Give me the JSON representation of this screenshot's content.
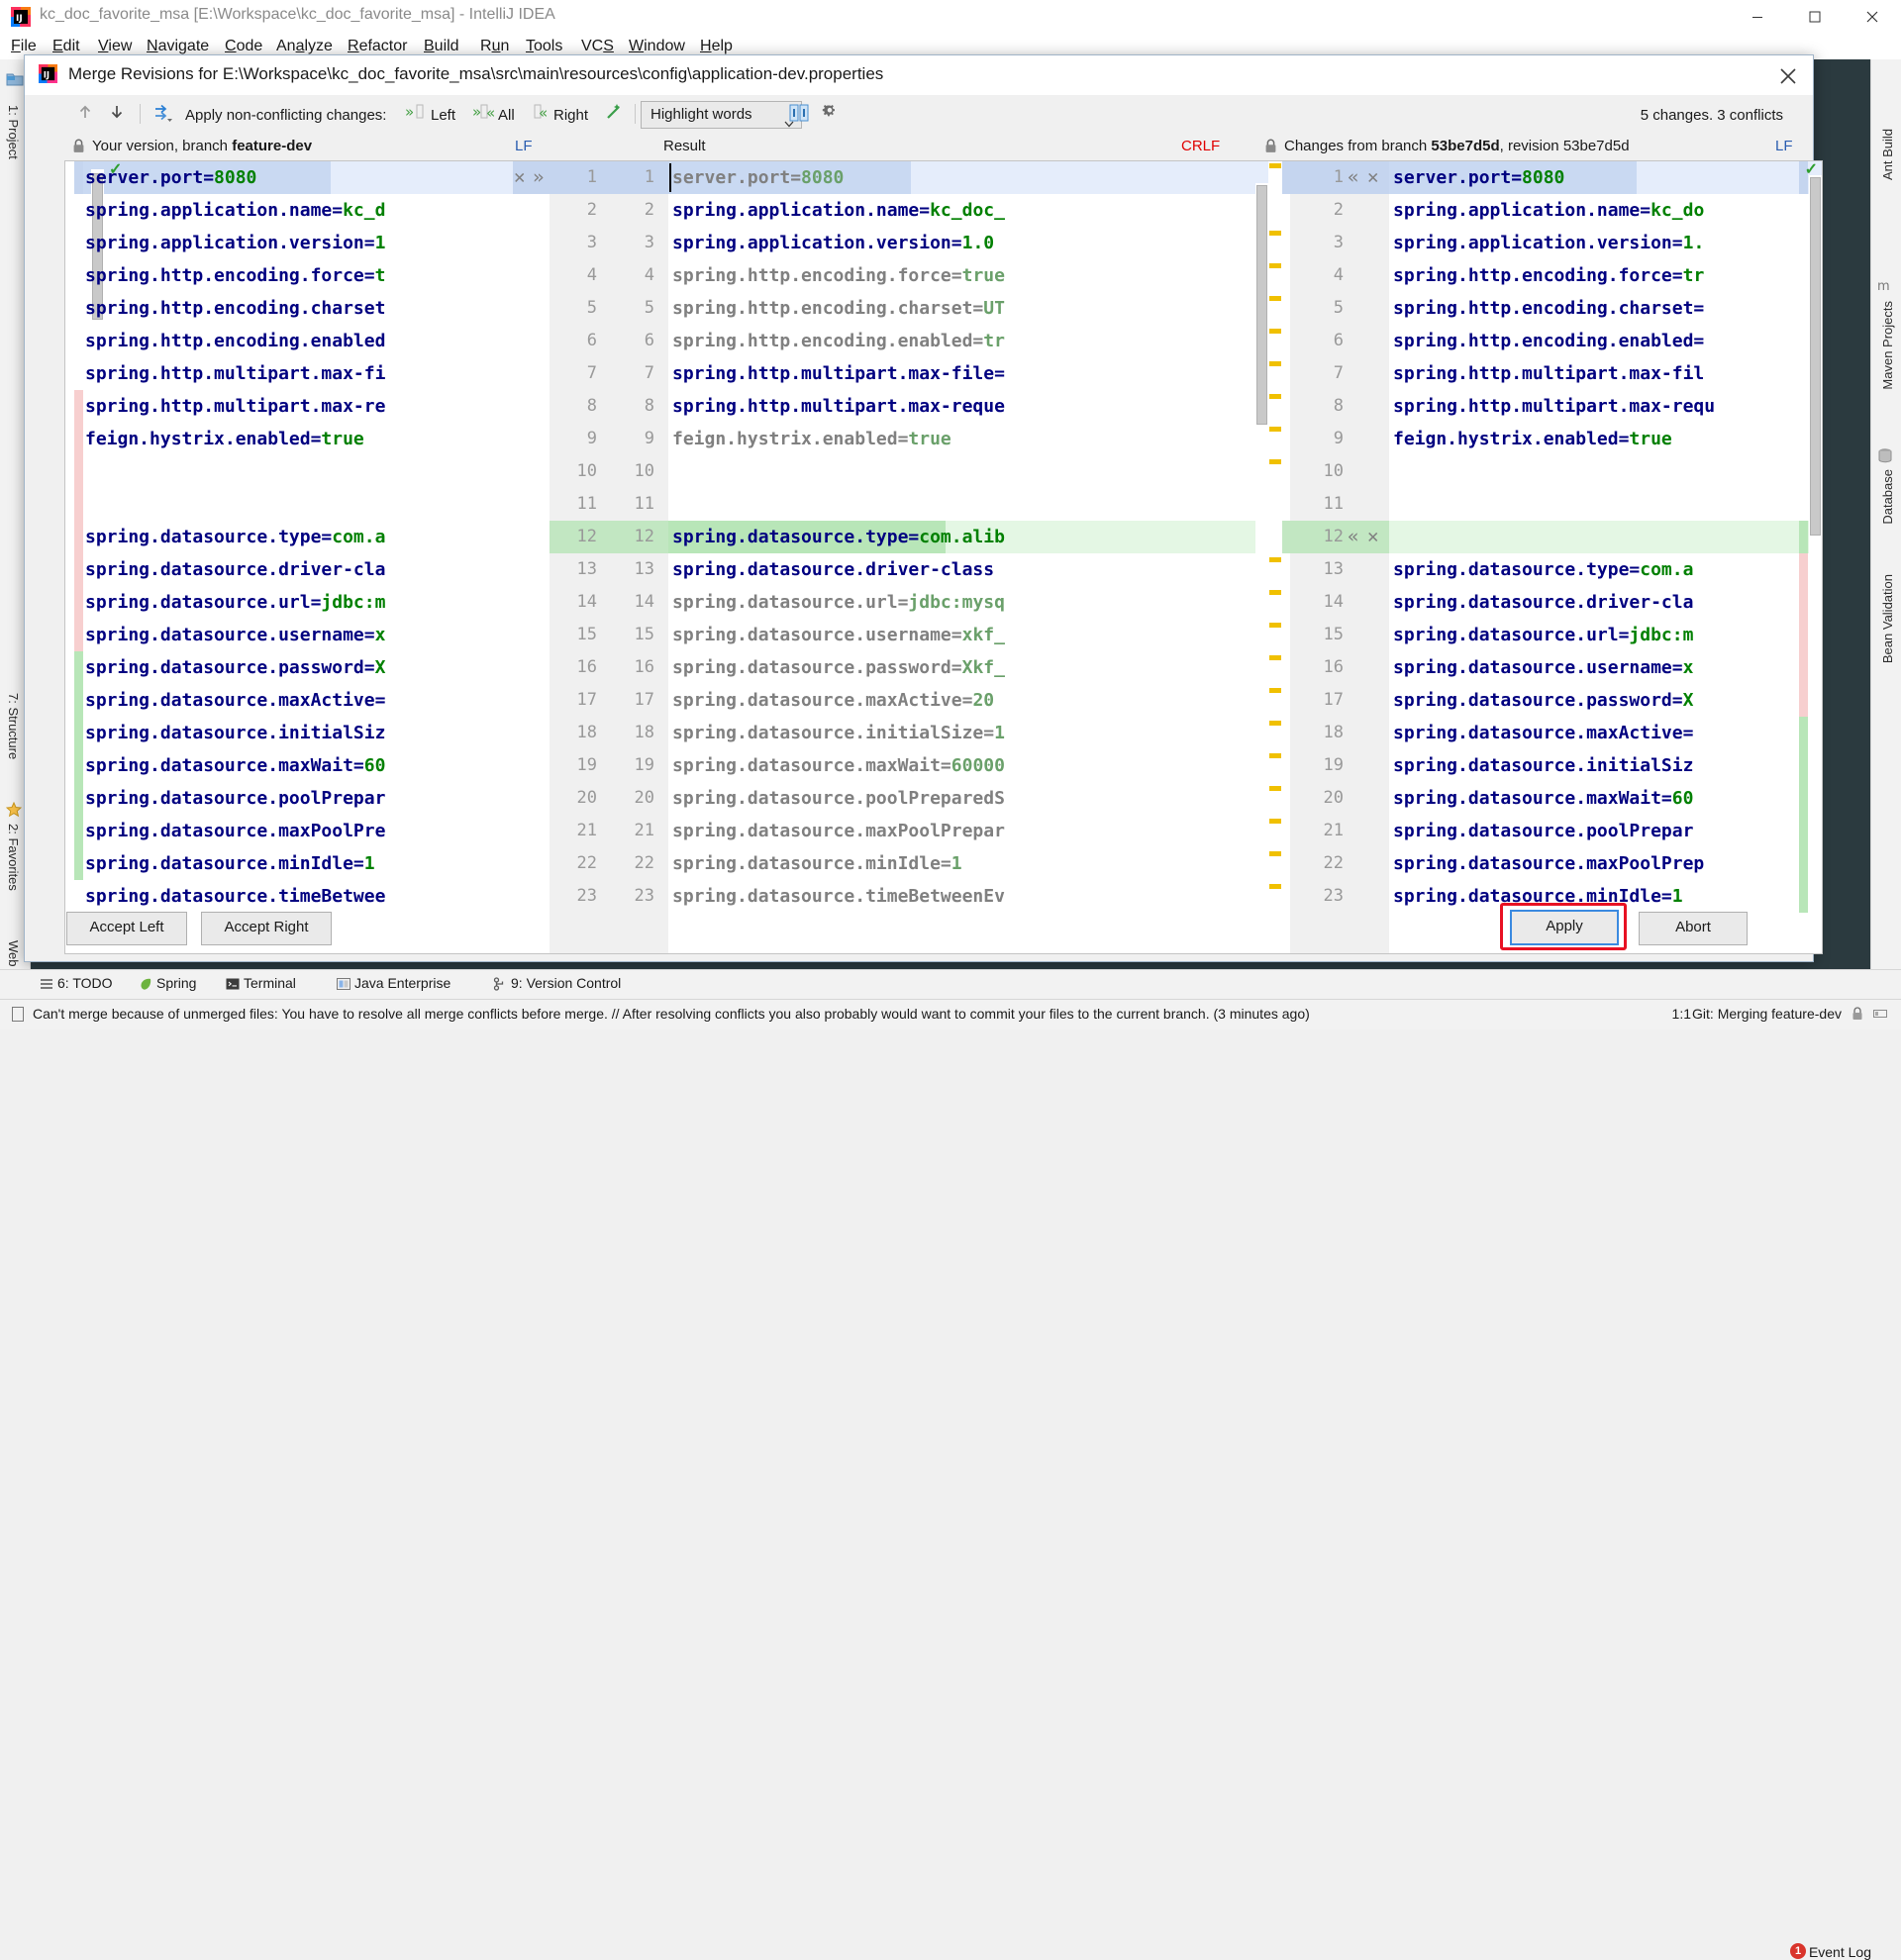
{
  "window": {
    "title": "kc_doc_favorite_msa [E:\\Workspace\\kc_doc_favorite_msa] - IntelliJ IDEA",
    "minimize_icon": "minimize-icon",
    "maximize_icon": "maximize-icon",
    "close_icon": "close-icon"
  },
  "menubar": {
    "items": [
      {
        "label": "File"
      },
      {
        "label": "Edit"
      },
      {
        "label": "View"
      },
      {
        "label": "Navigate"
      },
      {
        "label": "Code"
      },
      {
        "label": "Analyze"
      },
      {
        "label": "Refactor"
      },
      {
        "label": "Build"
      },
      {
        "label": "Run"
      },
      {
        "label": "Tools"
      },
      {
        "label": "VCS"
      },
      {
        "label": "Window"
      },
      {
        "label": "Help"
      }
    ]
  },
  "left_rail": {
    "items": [
      {
        "label": "1: Project"
      },
      {
        "label": "7: Structure"
      },
      {
        "label": "2: Favorites"
      },
      {
        "label": "Web"
      }
    ]
  },
  "right_rail": {
    "items": [
      {
        "label": "Ant Build"
      },
      {
        "label": "Maven Projects"
      },
      {
        "label": "Database"
      },
      {
        "label": "Bean Validation"
      }
    ]
  },
  "dialog": {
    "title": "Merge Revisions for E:\\Workspace\\kc_doc_favorite_msa\\src\\main\\resources\\config\\application-dev.properties",
    "close_icon": "close-icon",
    "toolbar": {
      "prev_icon": "arrow-up-icon",
      "next_icon": "arrow-down-icon",
      "apply_all_icon": "apply-non-conflicting-icon",
      "apply_label": "Apply non-conflicting changes:",
      "left_label": "Left",
      "all_label": "All",
      "right_label": "Right",
      "magic_icon": "magic-wand-icon",
      "highlight_mode": "Highlight words",
      "collapse_icon": "side-by-side-icon",
      "settings_icon": "gear-icon",
      "changes_summary": "5 changes. 3 conflicts"
    },
    "headers": {
      "left_lock_icon": "lock-icon",
      "left_title_prefix": "Your version, branch ",
      "left_branch": "feature-dev",
      "left_sep_label": "LF",
      "result_label": "Result",
      "result_sep_label": "CRLF",
      "right_lock_icon": "lock-icon",
      "right_title_prefix": "Changes from branch ",
      "right_branch": "53be7d5d",
      "right_title_suffix": ", revision 53be7d5d",
      "right_sep_label": "LF"
    },
    "buttons": {
      "accept_left": "Accept Left",
      "accept_right": "Accept Right",
      "apply": "Apply",
      "abort": "Abort"
    },
    "left_pane": {
      "lines": [
        {
          "n": 1,
          "key": "server.port=",
          "val": "8080",
          "state": "conflict-blue",
          "dim": false
        },
        {
          "n": 2,
          "key": "spring.application.name=",
          "val": "kc_d",
          "state": "none",
          "dim": false
        },
        {
          "n": 3,
          "key": "spring.application.version=",
          "val": "1",
          "state": "none",
          "dim": false
        },
        {
          "n": 4,
          "key": "spring.http.encoding.force=",
          "val": "t",
          "state": "none",
          "dim": false
        },
        {
          "n": 5,
          "key": "spring.http.encoding.charset",
          "val": "",
          "state": "none",
          "dim": false
        },
        {
          "n": 6,
          "key": "spring.http.encoding.enabled",
          "val": "",
          "state": "none",
          "dim": false
        },
        {
          "n": 7,
          "key": "spring.http.multipart.max-fi",
          "val": "",
          "state": "none",
          "dim": false
        },
        {
          "n": 8,
          "key": "spring.http.multipart.max-re",
          "val": "",
          "state": "none",
          "dim": false
        },
        {
          "n": 9,
          "key": "feign.hystrix.enabled=",
          "val": "true",
          "state": "none",
          "dim": false
        },
        {
          "n": 10,
          "key": "",
          "val": "",
          "state": "none",
          "dim": false
        },
        {
          "n": 11,
          "key": "",
          "val": "",
          "state": "none",
          "dim": false
        },
        {
          "n": 12,
          "key": "spring.datasource.type=",
          "val": "com.a",
          "state": "conflict",
          "dim": false
        },
        {
          "n": 13,
          "key": "spring.datasource.driver-cla",
          "val": "",
          "state": "conflict",
          "dim": false
        },
        {
          "n": 14,
          "key": "spring.datasource.url=",
          "val": "jdbc:m",
          "state": "conflict",
          "dim": false
        },
        {
          "n": 15,
          "key": "spring.datasource.username=",
          "val": "x",
          "state": "conflict",
          "dim": false
        },
        {
          "n": 16,
          "key": "spring.datasource.password=",
          "val": "X",
          "state": "conflict",
          "dim": false
        },
        {
          "n": 17,
          "key": "spring.datasource.maxActive=",
          "val": "",
          "state": "change",
          "dim": false
        },
        {
          "n": 18,
          "key": "spring.datasource.initialSiz",
          "val": "",
          "state": "change",
          "dim": false
        },
        {
          "n": 19,
          "key": "spring.datasource.maxWait=",
          "val": "60",
          "state": "change",
          "dim": false
        },
        {
          "n": 20,
          "key": "spring.datasource.poolPrepar",
          "val": "",
          "state": "change",
          "dim": false
        },
        {
          "n": 21,
          "key": "spring.datasource.maxPoolPre",
          "val": "",
          "state": "change",
          "dim": false
        },
        {
          "n": 22,
          "key": "spring.datasource.minIdle=",
          "val": "1",
          "state": "change",
          "dim": false
        },
        {
          "n": 23,
          "key": "spring.datasource.timeBetwee",
          "val": "",
          "state": "change",
          "dim": false
        }
      ]
    },
    "center_pane": {
      "lines": [
        {
          "n": 1,
          "key": "server.port=",
          "val": "8080",
          "state": "conflict-blue",
          "dim": true,
          "marker": "X »"
        },
        {
          "n": 2,
          "key": "spring.application.name=",
          "val": "kc_doc_",
          "state": "none",
          "dim": false
        },
        {
          "n": 3,
          "key": "spring.application.version=",
          "val": "1.0",
          "state": "none",
          "dim": false
        },
        {
          "n": 4,
          "key": "spring.http.encoding.force=",
          "val": "true",
          "state": "none",
          "dim": true
        },
        {
          "n": 5,
          "key": "spring.http.encoding.charset=",
          "val": "UT",
          "state": "none",
          "dim": true
        },
        {
          "n": 6,
          "key": "spring.http.encoding.enabled=",
          "val": "tr",
          "state": "none",
          "dim": true
        },
        {
          "n": 7,
          "key": "spring.http.multipart.max-file=",
          "val": "",
          "state": "none",
          "dim": false
        },
        {
          "n": 8,
          "key": "spring.http.multipart.max-reque",
          "val": "",
          "state": "none",
          "dim": false
        },
        {
          "n": 9,
          "key": "feign.hystrix.enabled=",
          "val": "true",
          "state": "none",
          "dim": true
        },
        {
          "n": 10,
          "key": "",
          "val": "",
          "state": "none",
          "dim": false
        },
        {
          "n": 11,
          "key": "",
          "val": "",
          "state": "none",
          "dim": false
        },
        {
          "n": 12,
          "key": "spring.datasource.type=",
          "val": "com.alib",
          "state": "conflict-green",
          "dim": false
        },
        {
          "n": 13,
          "key": "spring.datasource.driver-class",
          "val": "",
          "state": "none",
          "dim": false
        },
        {
          "n": 14,
          "key": "spring.datasource.url=",
          "val": "jdbc:mysq",
          "state": "none",
          "dim": true
        },
        {
          "n": 15,
          "key": "spring.datasource.username=",
          "val": "xkf_",
          "state": "none",
          "dim": true
        },
        {
          "n": 16,
          "key": "spring.datasource.password=",
          "val": "Xkf_",
          "state": "none",
          "dim": true
        },
        {
          "n": 17,
          "key": "spring.datasource.maxActive=",
          "val": "20",
          "state": "none",
          "dim": true
        },
        {
          "n": 18,
          "key": "spring.datasource.initialSize=",
          "val": "1",
          "state": "none",
          "dim": true
        },
        {
          "n": 19,
          "key": "spring.datasource.maxWait=",
          "val": "60000",
          "state": "none",
          "dim": true
        },
        {
          "n": 20,
          "key": "spring.datasource.poolPreparedS",
          "val": "",
          "state": "none",
          "dim": true
        },
        {
          "n": 21,
          "key": "spring.datasource.maxPoolPrepar",
          "val": "",
          "state": "none",
          "dim": true
        },
        {
          "n": 22,
          "key": "spring.datasource.minIdle=",
          "val": "1",
          "state": "none",
          "dim": true
        },
        {
          "n": 23,
          "key": "spring.datasource.timeBetweenEv",
          "val": "",
          "state": "none",
          "dim": true
        }
      ]
    },
    "right_pane": {
      "lines": [
        {
          "n": 1,
          "key": "server.port=",
          "val": "8080",
          "state": "conflict-blue",
          "dim": false,
          "marker": "« X"
        },
        {
          "n": 2,
          "key": "spring.application.name=",
          "val": "kc_do",
          "state": "none",
          "dim": false
        },
        {
          "n": 3,
          "key": "spring.application.version=",
          "val": "1.",
          "state": "none",
          "dim": false
        },
        {
          "n": 4,
          "key": "spring.http.encoding.force=",
          "val": "tr",
          "state": "none",
          "dim": false
        },
        {
          "n": 5,
          "key": "spring.http.encoding.charset=",
          "val": "",
          "state": "none",
          "dim": false
        },
        {
          "n": 6,
          "key": "spring.http.encoding.enabled=",
          "val": "",
          "state": "none",
          "dim": false
        },
        {
          "n": 7,
          "key": "spring.http.multipart.max-fil",
          "val": "",
          "state": "none",
          "dim": false
        },
        {
          "n": 8,
          "key": "spring.http.multipart.max-requ",
          "val": "",
          "state": "none",
          "dim": false
        },
        {
          "n": 9,
          "key": "feign.hystrix.enabled=",
          "val": "true",
          "state": "none",
          "dim": false
        },
        {
          "n": 10,
          "key": "",
          "val": "",
          "state": "none",
          "dim": false
        },
        {
          "n": 11,
          "key": "",
          "val": "",
          "state": "none",
          "dim": false
        },
        {
          "n": 12,
          "key": "",
          "val": "",
          "state": "conflict-green",
          "dim": false,
          "marker": "« X"
        },
        {
          "n": 13,
          "key": "spring.datasource.type=",
          "val": "com.a",
          "state": "conflict",
          "dim": false
        },
        {
          "n": 14,
          "key": "spring.datasource.driver-cla",
          "val": "",
          "state": "conflict",
          "dim": false
        },
        {
          "n": 15,
          "key": "spring.datasource.url=",
          "val": "jdbc:m",
          "state": "conflict",
          "dim": false
        },
        {
          "n": 16,
          "key": "spring.datasource.username=",
          "val": "x",
          "state": "conflict",
          "dim": false
        },
        {
          "n": 17,
          "key": "spring.datasource.password=",
          "val": "X",
          "state": "conflict",
          "dim": false
        },
        {
          "n": 18,
          "key": "spring.datasource.maxActive=",
          "val": "",
          "state": "change",
          "dim": false
        },
        {
          "n": 19,
          "key": "spring.datasource.initialSiz",
          "val": "",
          "state": "change",
          "dim": false
        },
        {
          "n": 20,
          "key": "spring.datasource.maxWait=",
          "val": "60",
          "state": "change",
          "dim": false
        },
        {
          "n": 21,
          "key": "spring.datasource.poolPrepar",
          "val": "",
          "state": "change",
          "dim": false
        },
        {
          "n": 22,
          "key": "spring.datasource.maxPoolPrep",
          "val": "",
          "state": "change",
          "dim": false
        },
        {
          "n": 23,
          "key": "spring.datasource.minIdle=",
          "val": "1",
          "state": "change",
          "dim": false
        }
      ]
    }
  },
  "toolstrip": {
    "items": [
      {
        "label": "6: TODO",
        "icon": "todo-icon"
      },
      {
        "label": "Spring",
        "icon": "spring-leaf-icon"
      },
      {
        "label": "Terminal",
        "icon": "terminal-icon"
      },
      {
        "label": "Java Enterprise",
        "icon": "java-enterprise-icon"
      },
      {
        "label": "9: Version Control",
        "icon": "version-control-icon"
      }
    ],
    "event_log": "Event Log",
    "event_log_count": "1"
  },
  "statusbar": {
    "message": "Can't merge because of unmerged files: You have to resolve all merge conflicts before merge. // After resolving conflicts you also probably would want to commit your files to the current branch. (3 minutes ago)",
    "caret_position": "1:1",
    "git_status": "Git: Merging feature-dev"
  },
  "colors": {
    "accent": "#3b8ae0",
    "conflict_red": "#f5c6c6",
    "change_green": "#b8e6b8",
    "focus_ring": "#e81123",
    "code_key": "#000080",
    "code_value": "#008000"
  }
}
